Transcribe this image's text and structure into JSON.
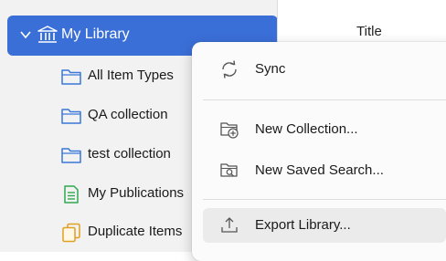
{
  "main": {
    "title_column": "Title"
  },
  "sidebar": {
    "library": {
      "label": "My Library",
      "icon": "library-icon"
    },
    "items": [
      {
        "label": "All Item Types",
        "icon": "folder-icon"
      },
      {
        "label": "QA collection",
        "icon": "folder-icon"
      },
      {
        "label": "test collection",
        "icon": "folder-icon"
      },
      {
        "label": "My Publications",
        "icon": "publications-icon"
      },
      {
        "label": "Duplicate Items",
        "icon": "duplicate-items-icon"
      }
    ]
  },
  "context_menu": {
    "items": [
      {
        "label": "Sync",
        "icon": "sync-icon"
      },
      {
        "label": "New Collection...",
        "icon": "new-collection-icon"
      },
      {
        "label": "New Saved Search...",
        "icon": "new-saved-search-icon"
      },
      {
        "label": "Export Library...",
        "icon": "export-icon"
      }
    ]
  },
  "colors": {
    "selection": "#3b6fd8",
    "folder": "#3b78d8",
    "publications": "#2fa84f",
    "duplicate": "#e0a020"
  }
}
